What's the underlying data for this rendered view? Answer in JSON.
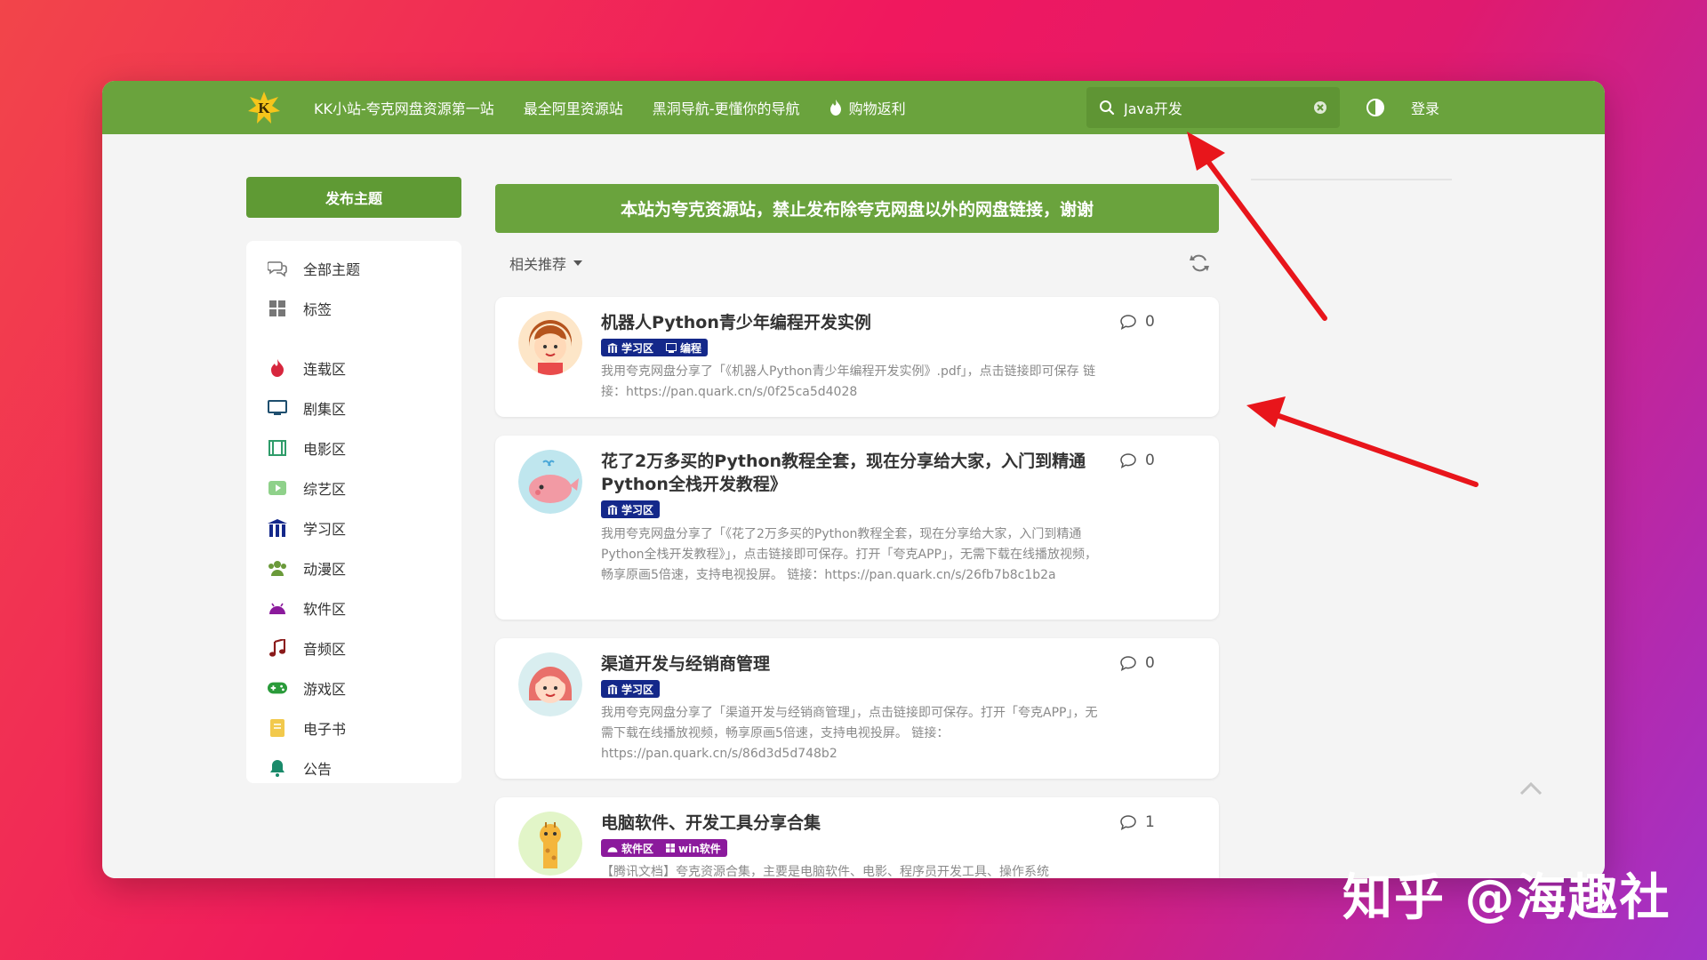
{
  "nav": {
    "items": [
      {
        "label": "KK小站-夸克网盘资源第一站"
      },
      {
        "label": "最全阿里资源站"
      },
      {
        "label": "黑洞导航-更懂你的导航"
      },
      {
        "label": "购物返利"
      }
    ],
    "search_value": "Java开发",
    "login": "登录"
  },
  "sidebar": {
    "publish": "发布主题",
    "items": [
      {
        "label": "全部主题",
        "icon": "comments-icon"
      },
      {
        "label": "标签",
        "icon": "grid-icon"
      },
      {
        "label": "连载区",
        "icon": "fire-icon"
      },
      {
        "label": "剧集区",
        "icon": "tv-icon"
      },
      {
        "label": "电影区",
        "icon": "film-icon"
      },
      {
        "label": "综艺区",
        "icon": "video-icon"
      },
      {
        "label": "学习区",
        "icon": "school-icon"
      },
      {
        "label": "动漫区",
        "icon": "users-icon"
      },
      {
        "label": "软件区",
        "icon": "android-icon"
      },
      {
        "label": "音频区",
        "icon": "music-icon"
      },
      {
        "label": "游戏区",
        "icon": "gamepad-icon"
      },
      {
        "label": "电子书",
        "icon": "book-icon"
      },
      {
        "label": "公告",
        "icon": "bell-icon"
      }
    ]
  },
  "main": {
    "notice": "本站为夸克资源站，禁止发布除夸克网盘以外的网盘链接，谢谢",
    "sort_label": "相关推荐",
    "posts": [
      {
        "title": "机器人Python青少年编程开发实例",
        "tags": [
          "学习区",
          "编程"
        ],
        "excerpt": "我用夸克网盘分享了「《机器人Python青少年编程开发实例》.pdf」，点击链接即可保存 链接：https://pan.quark.cn/s/0f25ca5d4028",
        "comments": "0"
      },
      {
        "title": "花了2万多买的Python教程全套，现在分享给大家，入门到精通 Python全栈开发教程》",
        "tags": [
          "学习区"
        ],
        "excerpt": "我用夸克网盘分享了「《花了2万多买的Python教程全套，现在分享给大家，入门到精通 Python全栈开发教程》」，点击链接即可保存。打开「夸克APP」，无需下载在线播放视频，畅享原画5倍速，支持电视投屏。 链接：https://pan.quark.cn/s/26fb7b8c1b2a",
        "comments": "0"
      },
      {
        "title": "渠道开发与经销商管理",
        "tags": [
          "学习区"
        ],
        "excerpt": "我用夸克网盘分享了「渠道开发与经销商管理」，点击链接即可保存。打开「夸克APP」，无需下载在线播放视频，畅享原画5倍速，支持电视投屏。 链接：https://pan.quark.cn/s/86d3d5d748b2",
        "comments": "0"
      },
      {
        "title": "电脑软件、开发工具分享合集",
        "tags": [
          "软件区",
          "win软件"
        ],
        "excerpt": "【腾讯文档】夸克资源合集，主要是电脑软件、电影、程序员开发工具、操作系统",
        "comments": "1"
      }
    ]
  },
  "watermark": "知乎 @海趣社",
  "colors": {
    "topbar": "#6aa33d",
    "tag_blue": "#14288a",
    "tag_purple": "#8b1a9c",
    "arrow": "#e8151b"
  }
}
